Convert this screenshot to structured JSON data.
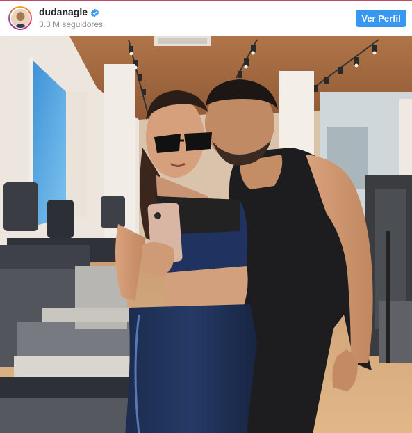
{
  "post": {
    "account": {
      "username": "dudanagle",
      "verified": true,
      "followers": "3.3 M seguidores"
    },
    "action": {
      "label": "Ver Perfil"
    },
    "photo_icon": "post-photo"
  },
  "colors": {
    "accent": "#3897f0",
    "top_border": "#c64a6a",
    "verified": "#3897f0"
  }
}
